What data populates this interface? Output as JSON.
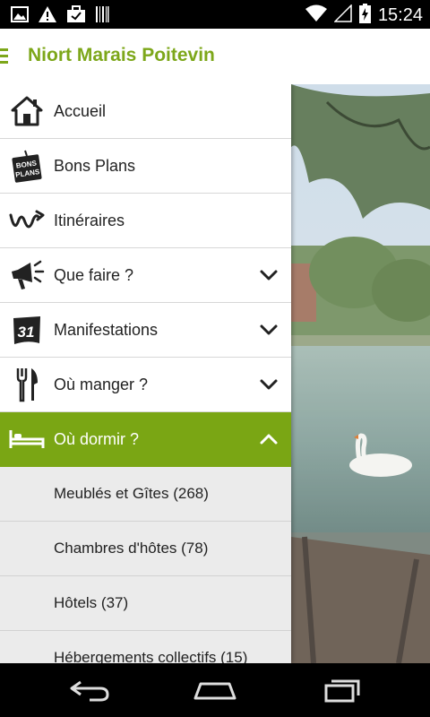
{
  "status_bar": {
    "time": "15:24",
    "icons": [
      "image-icon",
      "warning-icon",
      "briefcase-icon",
      "barcode-icon",
      "wifi-icon",
      "signal-icon",
      "battery-icon"
    ]
  },
  "app_bar": {
    "title": "Niort Marais Poitevin",
    "accent_color": "#7da71a"
  },
  "drawer": {
    "items": [
      {
        "label": "Accueil",
        "icon": "home-icon"
      },
      {
        "label": "Bons Plans",
        "icon": "bons-plans-tag-icon",
        "icon_text": [
          "BONS",
          "PLANS"
        ]
      },
      {
        "label": "Itinéraires",
        "icon": "route-icon"
      },
      {
        "label": "Que faire ?",
        "icon": "megaphone-icon",
        "expandable": true
      },
      {
        "label": "Manifestations",
        "icon": "calendar-icon",
        "icon_text": "31",
        "expandable": true
      },
      {
        "label": "Où manger ?",
        "icon": "cutlery-icon",
        "expandable": true
      },
      {
        "label": "Où dormir ?",
        "icon": "bed-icon",
        "expandable": true,
        "expanded": true
      }
    ],
    "sub_items": [
      {
        "label": "Meublés et Gîtes (268)"
      },
      {
        "label": "Chambres d'hôtes (78)"
      },
      {
        "label": "Hôtels (37)"
      },
      {
        "label": "Hébergements collectifs (15)"
      }
    ],
    "active_color": "#7aa614"
  },
  "nav_bar": {
    "buttons": [
      "back-icon",
      "home-button-icon",
      "recent-apps-icon"
    ]
  }
}
